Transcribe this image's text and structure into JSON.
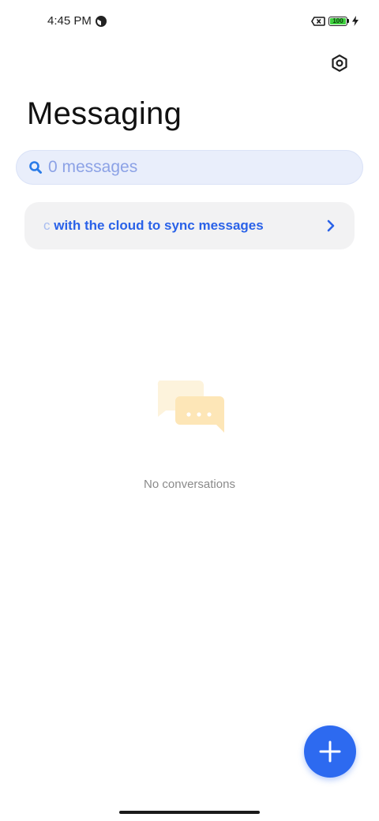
{
  "status_bar": {
    "time": "4:45 PM",
    "battery_level": "100",
    "battery_fraction": 1.0,
    "battery_color": "#3ecf3e",
    "icons": [
      "data-saver-icon",
      "sim-error-icon",
      "battery-icon",
      "charging-bolt-icon"
    ]
  },
  "header": {
    "title": "Messaging",
    "settings_icon": "settings-hexagon-icon"
  },
  "search": {
    "placeholder": "0 messages",
    "value": "",
    "icon": "search-icon"
  },
  "sync_banner": {
    "leading_fragment": "c",
    "text": "with the cloud to sync messages",
    "icon": "chevron-right-icon",
    "accent_color": "#2a62e8"
  },
  "empty_state": {
    "illustration": "chat-bubbles-icon",
    "text": "No conversations"
  },
  "fab": {
    "icon": "plus-icon",
    "color": "#2d6af0"
  }
}
